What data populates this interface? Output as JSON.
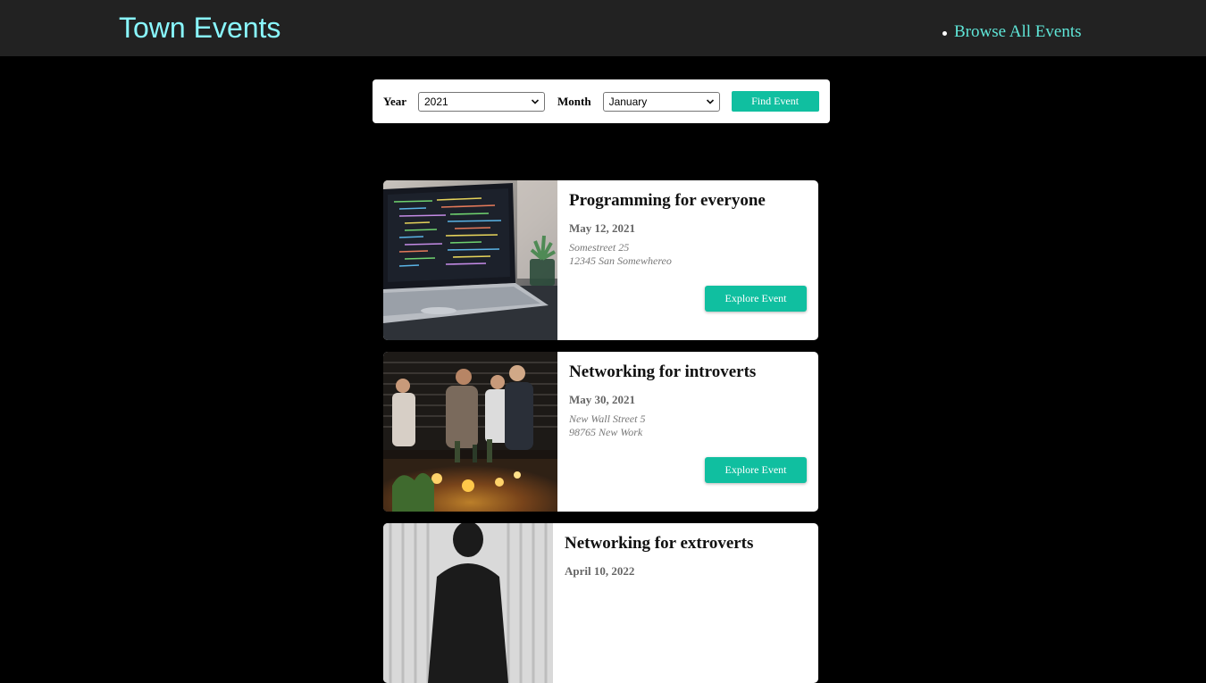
{
  "header": {
    "brand": "Town Events",
    "nav": [
      {
        "label": "Browse All Events"
      }
    ]
  },
  "filter": {
    "year_label": "Year",
    "year_value": "2021",
    "month_label": "Month",
    "month_value": "January",
    "find_label": "Find Event"
  },
  "events": [
    {
      "title": "Programming for everyone",
      "date": "May 12, 2021",
      "address_line1": "Somestreet 25",
      "address_line2": "12345 San Somewhereo",
      "button_label": "Explore Event",
      "image": "laptop-code-photo"
    },
    {
      "title": "Networking for introverts",
      "date": "May 30, 2021",
      "address_line1": "New Wall Street 5",
      "address_line2": "98765 New Work",
      "button_label": "Explore Event",
      "image": "people-networking-photo"
    },
    {
      "title": "Networking for extroverts",
      "date": "April 10, 2022",
      "image": "silhouette-photo"
    }
  ],
  "colors": {
    "accent": "#10bfa0",
    "brand": "#89f7fe",
    "header_bg": "#222222",
    "page_bg": "#000000"
  }
}
